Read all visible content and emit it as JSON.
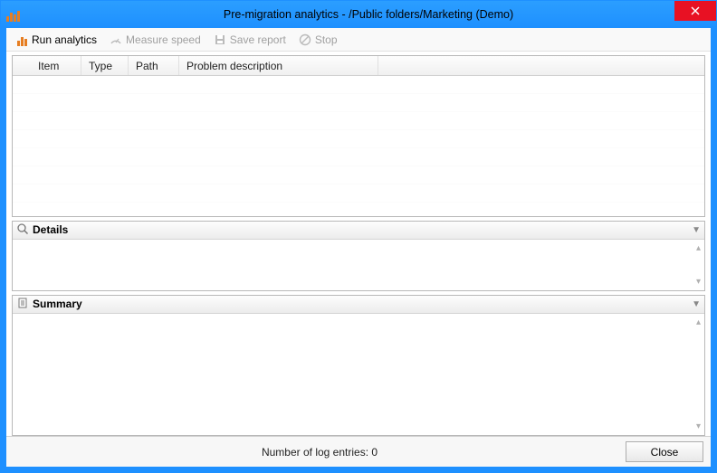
{
  "window": {
    "title": "Pre-migration analytics - /Public folders/Marketing (Demo)"
  },
  "toolbar": {
    "run_analytics": "Run analytics",
    "measure_speed": "Measure speed",
    "save_report": "Save report",
    "stop": "Stop"
  },
  "grid": {
    "columns": {
      "item": "Item",
      "type": "Type",
      "path": "Path",
      "problem": "Problem description"
    }
  },
  "sections": {
    "details": "Details",
    "summary": "Summary"
  },
  "footer": {
    "status": "Number of log entries: 0",
    "close": "Close"
  }
}
